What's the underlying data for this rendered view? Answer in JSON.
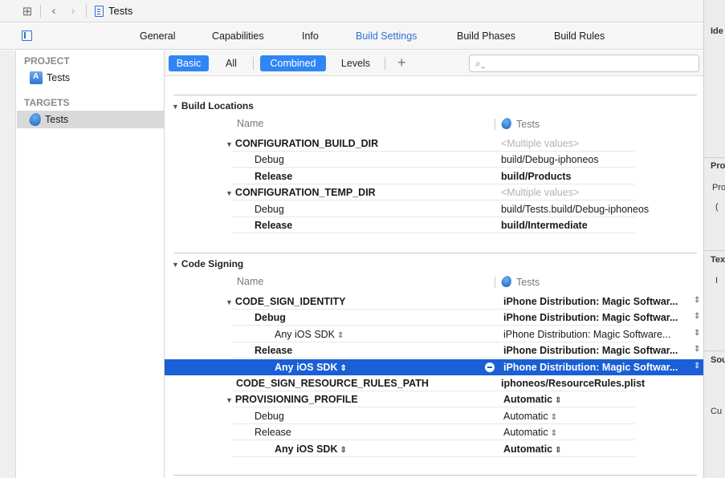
{
  "jumpbar": {
    "title": "Tests"
  },
  "tabs": [
    "General",
    "Capabilities",
    "Info",
    "Build Settings",
    "Build Phases",
    "Build Rules"
  ],
  "active_tab": "Build Settings",
  "sidebar": {
    "project_header": "PROJECT",
    "project_item": "Tests",
    "targets_header": "TARGETS",
    "target_item": "Tests"
  },
  "filter": {
    "basic": "Basic",
    "all": "All",
    "combined": "Combined",
    "levels": "Levels",
    "search_icon": "⌕⌄"
  },
  "inspector": {
    "labels": [
      "Ide",
      "Pro",
      "Pro",
      "(",
      "Tex",
      "I",
      "Sou",
      "Cu"
    ]
  },
  "sections": [
    {
      "title": "Build Locations",
      "col_name": "Name",
      "col_target": "Tests",
      "rows": [
        {
          "indent": 0,
          "disclosure": true,
          "name": "CONFIGURATION_BUILD_DIR",
          "bold_name": true,
          "value": "<Multiple values>",
          "muted": true
        },
        {
          "indent": 1,
          "name": "Debug",
          "value": "build/Debug-iphoneos"
        },
        {
          "indent": 1,
          "name": "Release",
          "bold_name": true,
          "value": "build/Products",
          "bold_value": true
        },
        {
          "indent": 0,
          "disclosure": true,
          "name": "CONFIGURATION_TEMP_DIR",
          "bold_name": true,
          "value": "<Multiple values>",
          "muted": true
        },
        {
          "indent": 1,
          "name": "Debug",
          "value": "build/Tests.build/Debug-iphoneos"
        },
        {
          "indent": 1,
          "name": "Release",
          "bold_name": true,
          "value": "build/Intermediate",
          "bold_value": true
        }
      ]
    },
    {
      "title": "Code Signing",
      "col_name": "Name",
      "col_target": "Tests",
      "rows": [
        {
          "indent": 0,
          "disclosure": true,
          "name": "CODE_SIGN_IDENTITY",
          "bold_name": true,
          "value": "iPhone Distribution: Magic Softwar...",
          "bold_value": true,
          "rstep": true
        },
        {
          "indent": 1,
          "name": "Debug",
          "bold_name": true,
          "value": "iPhone Distribution: Magic Softwar...",
          "bold_value": true,
          "rstep": true
        },
        {
          "indent": 2,
          "name": "Any iOS SDK",
          "stepper": true,
          "value": "iPhone Distribution: Magic Software...",
          "rstep": true
        },
        {
          "indent": 1,
          "name": "Release",
          "bold_name": true,
          "value": "iPhone Distribution: Magic Softwar...",
          "bold_value": true,
          "rstep": true
        },
        {
          "indent": 2,
          "name": "Any iOS SDK",
          "bold_name": true,
          "stepper": true,
          "value": "iPhone Distribution: Magic Softwar...",
          "bold_value": true,
          "rstep": true,
          "selected": true
        },
        {
          "indent": 0,
          "name": "CODE_SIGN_RESOURCE_RULES_PATH",
          "bold_name": true,
          "value": "iphoneos/ResourceRules.plist",
          "bold_value": true
        },
        {
          "indent": 0,
          "disclosure": true,
          "name": "PROVISIONING_PROFILE",
          "bold_name": true,
          "value": "Automatic",
          "bold_value": true,
          "vstep": true
        },
        {
          "indent": 1,
          "name": "Debug",
          "value": "Automatic",
          "vstep": true
        },
        {
          "indent": 1,
          "name": "Release",
          "value": "Automatic",
          "vstep": true
        },
        {
          "indent": 2,
          "name": "Any iOS SDK",
          "bold_name": true,
          "stepper": true,
          "value": "Automatic",
          "bold_value": true,
          "vstep": true
        }
      ]
    }
  ]
}
